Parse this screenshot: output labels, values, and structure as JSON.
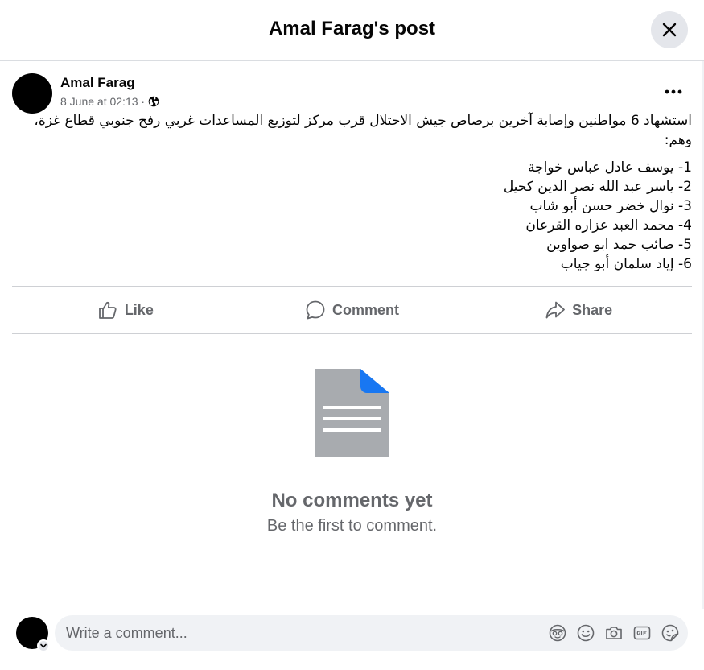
{
  "header": {
    "title": "Amal Farag's post"
  },
  "post": {
    "author": "Amal Farag",
    "timestamp": "8 June at 02:13 ·",
    "privacy_icon": "globe-icon",
    "intro": "استشهاد 6 مواطنين وإصابة آخرين برصاص جيش الاحتلال قرب مركز لتوزيع المساعدات غربي رفح جنوبي قطاع غزة، وهم:",
    "names": [
      "1- يوسف عادل عباس خواجة",
      "2- ياسر عبد الله نصر الدين كحيل",
      "3- نوال خضر حسن أبو شاب",
      "4- محمد العبد عزاره القرعان",
      "5- صائب حمد ابو صواوين",
      "6- إياد سلمان أبو جياب"
    ]
  },
  "actions": {
    "like": "Like",
    "comment": "Comment",
    "share": "Share"
  },
  "empty_state": {
    "title": "No comments yet",
    "subtitle": "Be the first to comment."
  },
  "composer": {
    "placeholder": "Write a comment...",
    "tools": [
      "avatar-sticker-icon",
      "emoji-icon",
      "camera-icon",
      "gif-icon",
      "sticker-icon"
    ]
  },
  "colors": {
    "accent": "#1877f2",
    "secondary_text": "#65676b",
    "divider": "#ced0d4",
    "input_bg": "#f0f2f5"
  }
}
